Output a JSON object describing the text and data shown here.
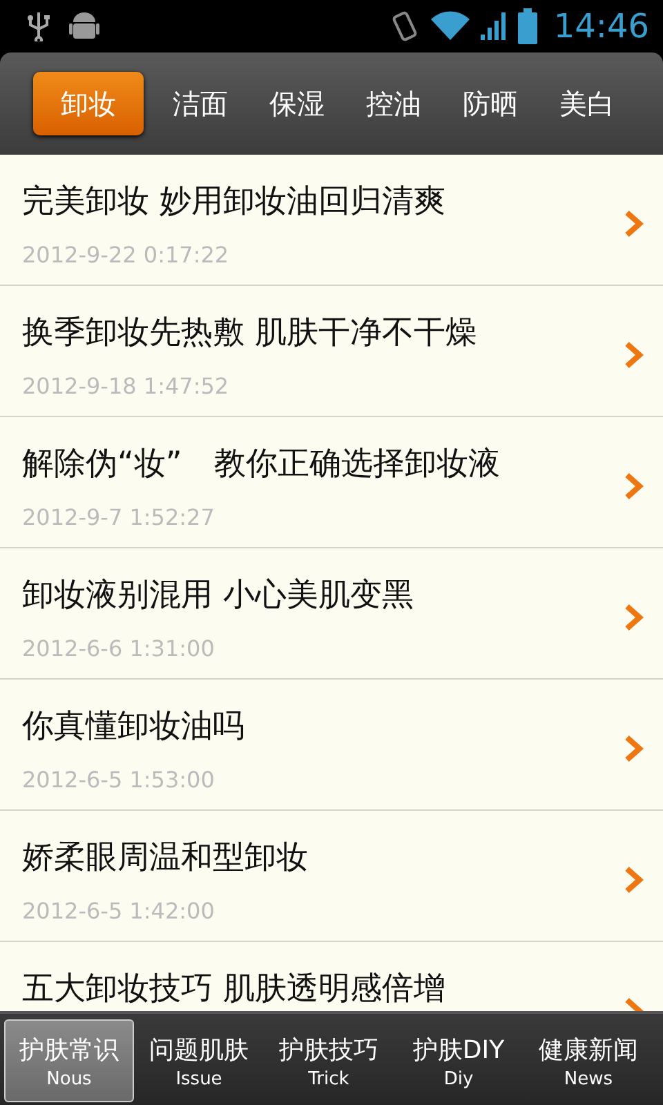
{
  "status_bar": {
    "time": "14:46"
  },
  "categories": [
    {
      "label": "卸妆",
      "selected": true
    },
    {
      "label": "洁面",
      "selected": false
    },
    {
      "label": "保湿",
      "selected": false
    },
    {
      "label": "控油",
      "selected": false
    },
    {
      "label": "防晒",
      "selected": false
    },
    {
      "label": "美白",
      "selected": false
    }
  ],
  "articles": [
    {
      "title": "完美卸妆 妙用卸妆油回归清爽",
      "date": "2012-9-22 0:17:22"
    },
    {
      "title": "换季卸妆先热敷 肌肤干净不干燥",
      "date": "2012-9-18 1:47:52"
    },
    {
      "title": "解除伪“妆”　教你正确选择卸妆液",
      "date": "2012-9-7 1:52:27"
    },
    {
      "title": "卸妆液别混用 小心美肌变黑",
      "date": "2012-6-6 1:31:00"
    },
    {
      "title": "你真懂卸妆油吗",
      "date": "2012-6-5 1:53:00"
    },
    {
      "title": "娇柔眼周温和型卸妆",
      "date": "2012-6-5 1:42:00"
    },
    {
      "title": "五大卸妆技巧 肌肤透明感倍增"
    }
  ],
  "bottom_nav": [
    {
      "label": "护肤常识",
      "sublabel": "Nous",
      "selected": true
    },
    {
      "label": "问题肌肤",
      "sublabel": "Issue",
      "selected": false
    },
    {
      "label": "护肤技巧",
      "sublabel": "Trick",
      "selected": false
    },
    {
      "label": "护肤DIY",
      "sublabel": "Diy",
      "selected": false
    },
    {
      "label": "健康新闻",
      "sublabel": "News",
      "selected": false
    }
  ]
}
